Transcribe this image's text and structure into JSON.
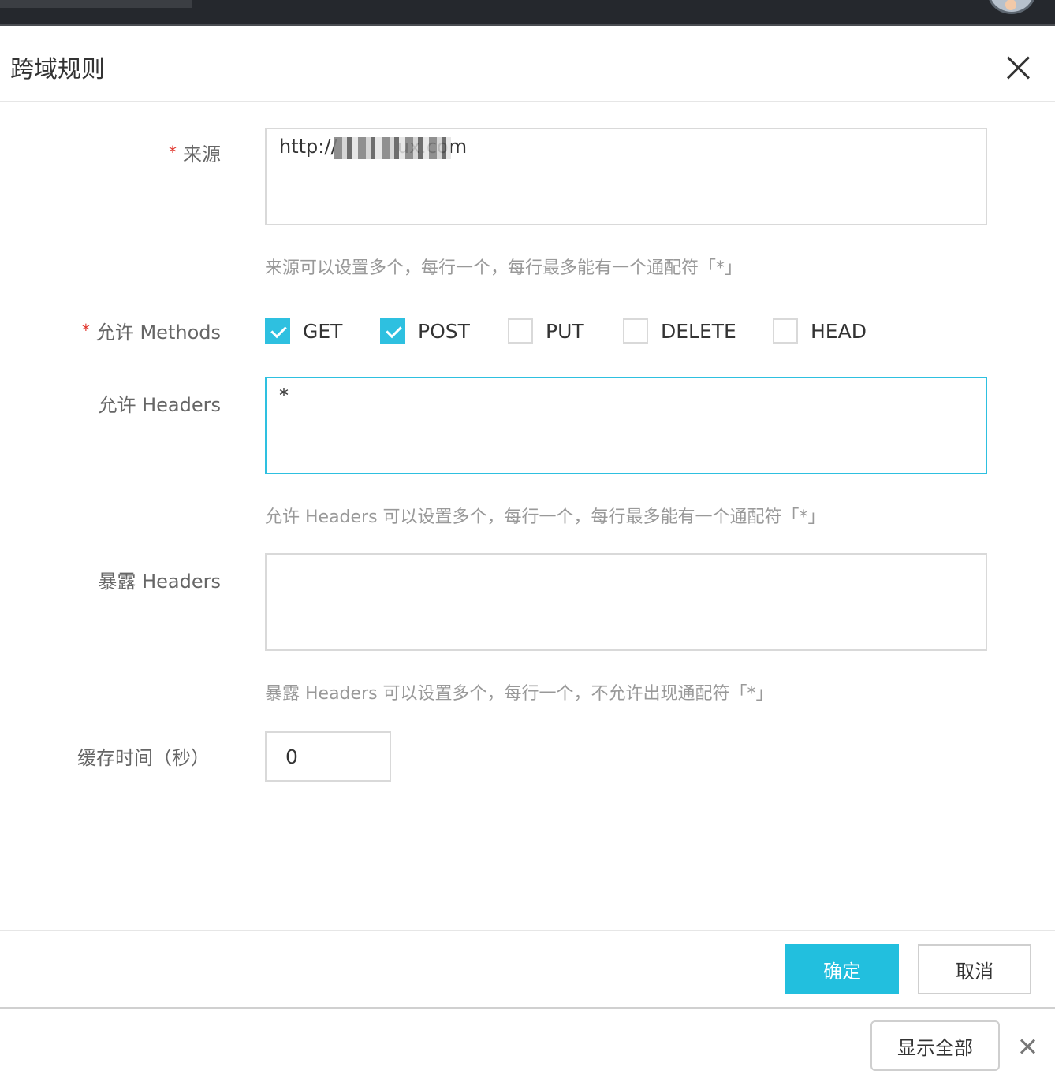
{
  "dialog": {
    "title": "跨域规则",
    "close_icon": "close-icon"
  },
  "form": {
    "origin": {
      "label": "来源",
      "required_mark": "*",
      "value": "http://          ux.com",
      "hint": "来源可以设置多个，每行一个，每行最多能有一个通配符「*」"
    },
    "methods": {
      "label": "允许 Methods",
      "required_mark": "*",
      "options": [
        {
          "label": "GET",
          "checked": true
        },
        {
          "label": "POST",
          "checked": true
        },
        {
          "label": "PUT",
          "checked": false
        },
        {
          "label": "DELETE",
          "checked": false
        },
        {
          "label": "HEAD",
          "checked": false
        }
      ]
    },
    "allow_headers": {
      "label": "允许 Headers",
      "value": "*",
      "hint": "允许 Headers 可以设置多个，每行一个，每行最多能有一个通配符「*」"
    },
    "expose_headers": {
      "label": "暴露 Headers",
      "value": "",
      "hint": "暴露 Headers 可以设置多个，每行一个，不允许出现通配符「*」"
    },
    "cache_time": {
      "label": "缓存时间（秒）",
      "value": "0"
    }
  },
  "footer": {
    "confirm_label": "确定",
    "cancel_label": "取消"
  },
  "bottombar": {
    "show_all_label": "显示全部"
  },
  "colors": {
    "accent": "#22bfde",
    "required": "#e0342b"
  }
}
